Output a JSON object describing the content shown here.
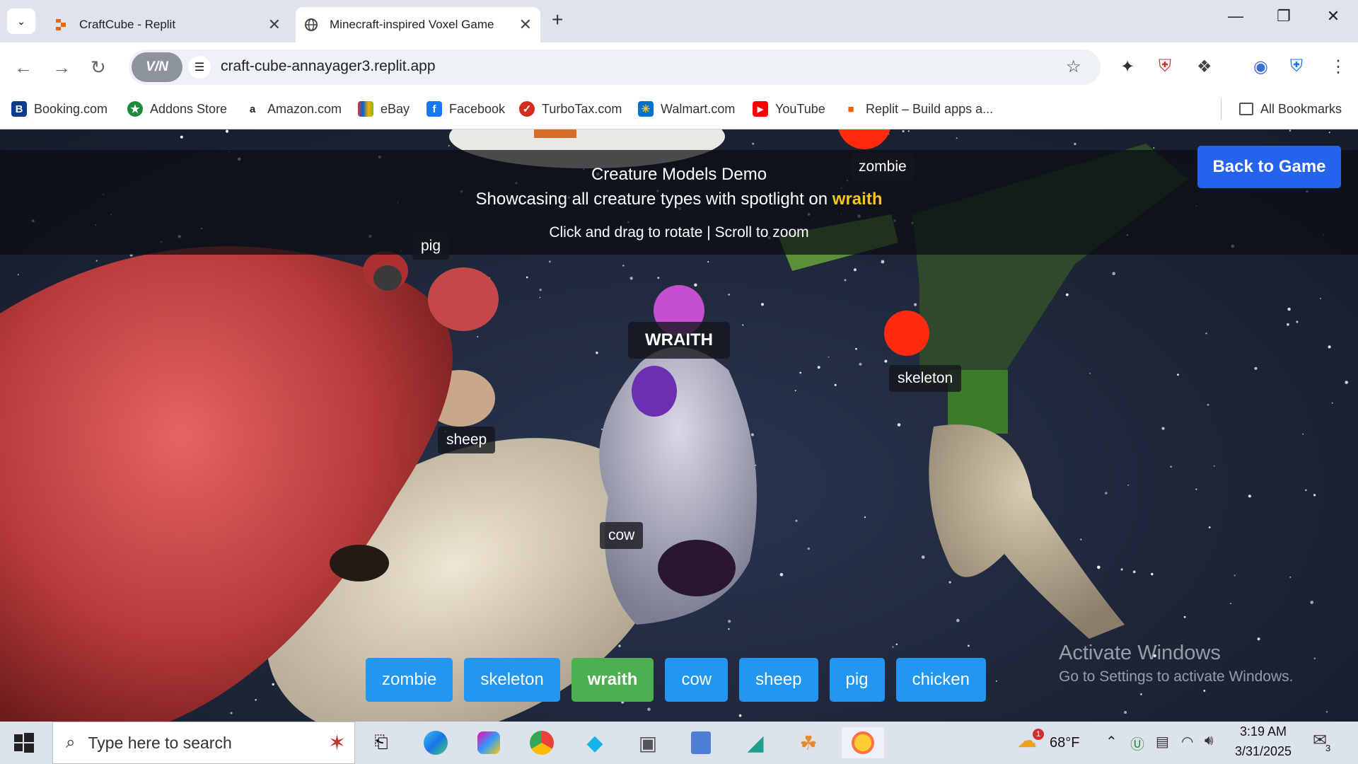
{
  "browser": {
    "tabs": [
      {
        "title": "CraftCube - Replit",
        "active": false
      },
      {
        "title": "Minecraft-inspired Voxel Game",
        "active": true
      }
    ],
    "url": "craft-cube-annayager3.replit.app",
    "vpn_label": "V/N",
    "bookmarks": [
      {
        "label": "Booking.com",
        "icon": "booking-icon",
        "color": "#0b3b8c"
      },
      {
        "label": "Addons Store",
        "icon": "addons-icon",
        "color": "#1d8a3d"
      },
      {
        "label": "Amazon.com",
        "icon": "amazon-icon",
        "color": "#222222"
      },
      {
        "label": "eBay",
        "icon": "ebay-icon",
        "color": "#e53238"
      },
      {
        "label": "Facebook",
        "icon": "facebook-icon",
        "color": "#1877f2"
      },
      {
        "label": "TurboTax.com",
        "icon": "turbotax-icon",
        "color": "#d52b1e"
      },
      {
        "label": "Walmart.com",
        "icon": "walmart-icon",
        "color": "#0071ce"
      },
      {
        "label": "YouTube",
        "icon": "youtube-icon",
        "color": "#ff0000"
      },
      {
        "label": "Replit – Build apps a...",
        "icon": "replit-icon",
        "color": "#f26207"
      }
    ],
    "all_bookmarks": "All Bookmarks"
  },
  "game": {
    "title": "Creature Models Demo",
    "subtitle_prefix": "Showcasing all creature types with spotlight on",
    "spotlight": "wraith",
    "hint": "Click and drag to rotate | Scroll to zoom",
    "back_button": "Back to Game",
    "labels": {
      "zombie": "zombie",
      "pig": "pig",
      "wraith": "WRAITH",
      "skeleton": "skeleton",
      "sheep": "sheep",
      "cow": "cow"
    },
    "creature_buttons": [
      "zombie",
      "skeleton",
      "wraith",
      "cow",
      "sheep",
      "pig",
      "chicken"
    ],
    "active_creature": "wraith"
  },
  "watermark": {
    "line1": "Activate Windows",
    "line2": "Go to Settings to activate Windows."
  },
  "taskbar": {
    "search_placeholder": "Type here to search",
    "weather": "68°F",
    "weather_badge": "1",
    "time": "3:19 AM",
    "date": "3/31/2025",
    "notifications": "3"
  },
  "colors": {
    "accent_blue": "#2463eb",
    "button_blue": "#2196f3",
    "active_green": "#4caf50",
    "highlight_yellow": "#f5c518"
  }
}
